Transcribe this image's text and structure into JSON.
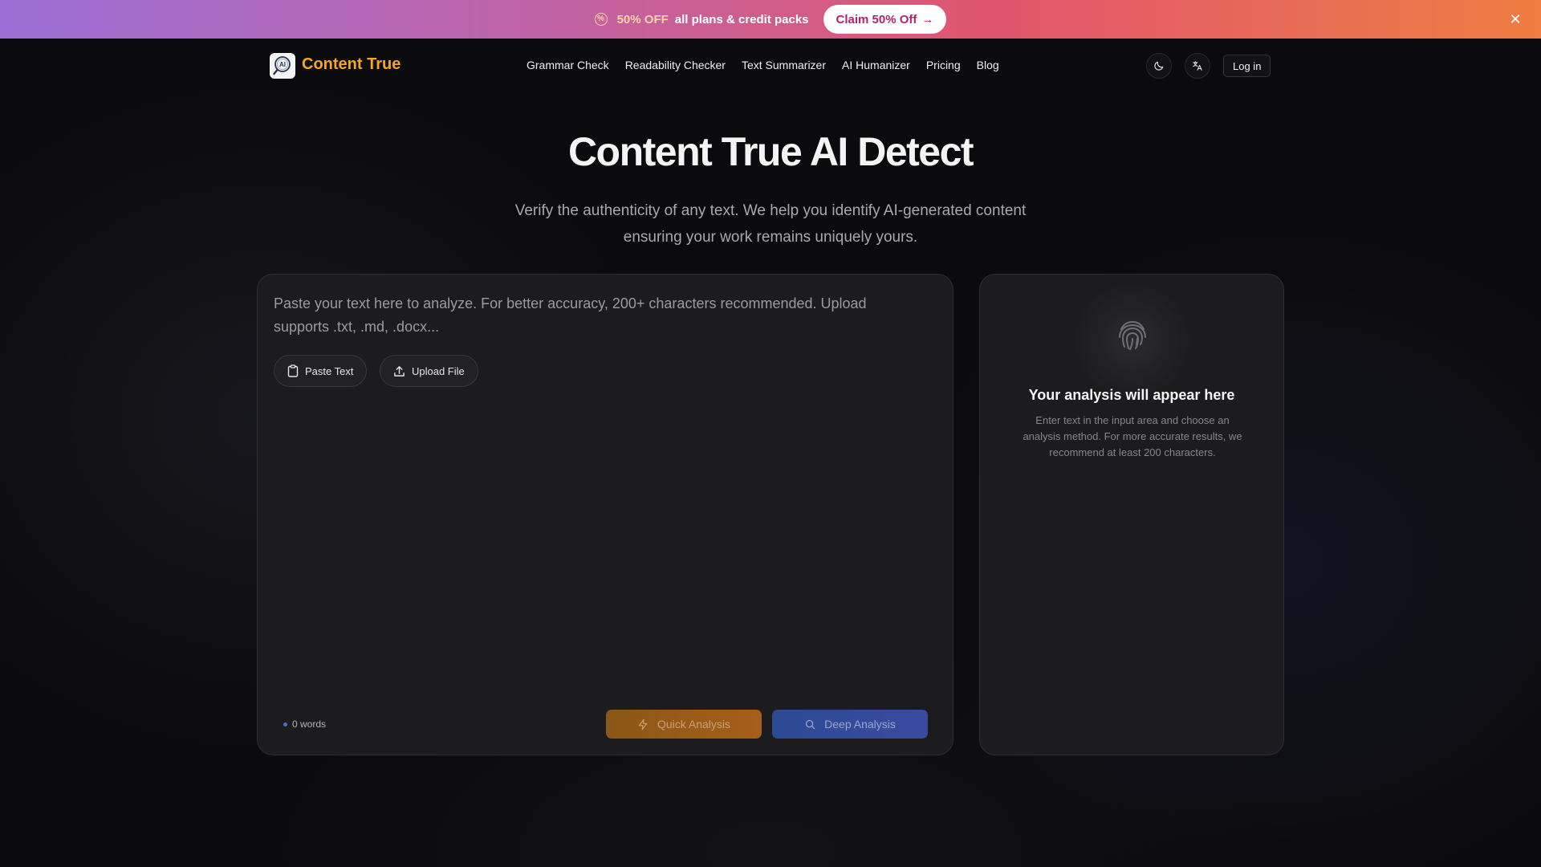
{
  "promo": {
    "discount": "50% OFF",
    "text": "all plans & credit packs",
    "cta_label": "Claim 50% Off",
    "cta_arrow": "→",
    "close_glyph": "✕"
  },
  "nav": {
    "brand": "Content True",
    "links": [
      "Grammar Check",
      "Readability Checker",
      "Text Summarizer",
      "AI Humanizer",
      "Pricing",
      "Blog"
    ],
    "login_label": "Log in",
    "theme_icon": "moon-icon",
    "language_icon": "translate-icon"
  },
  "hero": {
    "title": "Content True AI Detect",
    "subtitle": "Verify the authenticity of any text. We help you identify AI-generated content ensuring your work remains uniquely yours."
  },
  "input": {
    "placeholder": "Paste your text here to analyze. For better accuracy, 200+ characters recommended. Upload supports .txt, .md, .docx...",
    "paste_label": "Paste Text",
    "upload_label": "Upload File",
    "word_count": "0 words",
    "quick_label": "Quick Analysis",
    "deep_label": "Deep Analysis"
  },
  "result": {
    "title": "Your analysis will appear here",
    "description": "Enter text in the input area and choose an analysis method. For more accurate results, we recommend at least 200 characters."
  },
  "colors": {
    "brand": "#f5a623",
    "quick": "#a65f1a",
    "deep": "#3b4aa0",
    "background": "#0b0b0d"
  }
}
